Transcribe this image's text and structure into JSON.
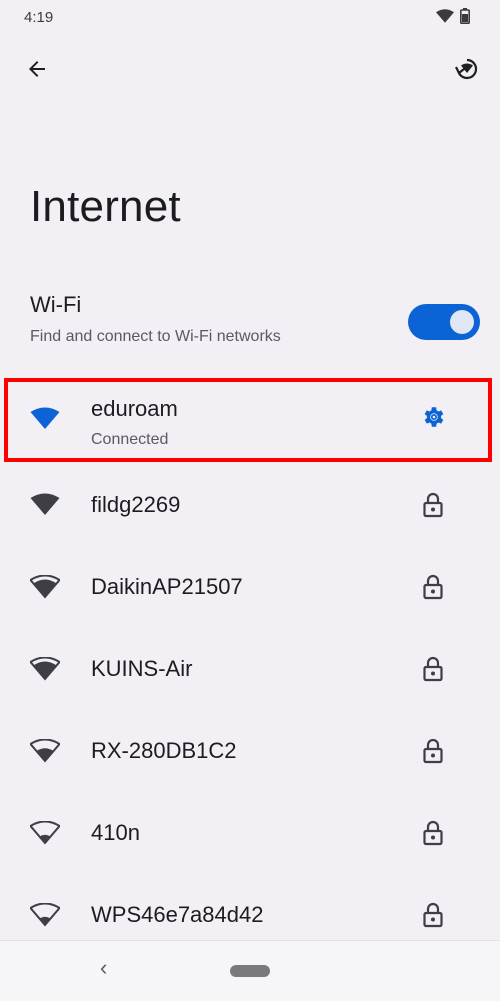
{
  "status_bar": {
    "time": "4:19"
  },
  "page": {
    "title": "Internet"
  },
  "wifi": {
    "title": "Wi-Fi",
    "subtitle": "Find and connect to Wi-Fi networks",
    "enabled": true
  },
  "networks": [
    {
      "name": "eduroam",
      "status": "Connected",
      "trailing_icon": "gear-icon",
      "signal": "full"
    },
    {
      "name": "fildg2269",
      "status": "",
      "trailing_icon": "lock-icon",
      "signal": "full"
    },
    {
      "name": "DaikinAP21507",
      "status": "",
      "trailing_icon": "lock-icon",
      "signal": "high"
    },
    {
      "name": "KUINS-Air",
      "status": "",
      "trailing_icon": "lock-icon",
      "signal": "high"
    },
    {
      "name": "RX-280DB1C2",
      "status": "",
      "trailing_icon": "lock-icon",
      "signal": "medium"
    },
    {
      "name": "410n",
      "status": "",
      "trailing_icon": "lock-icon",
      "signal": "low"
    },
    {
      "name": "WPS46e7a84d42",
      "status": "",
      "trailing_icon": "lock-icon",
      "signal": "low"
    }
  ],
  "colors": {
    "accent": "#0c63d6",
    "background": "#f2eff5",
    "highlight": "#ff0000"
  },
  "nav": {
    "back_glyph": "‹"
  }
}
